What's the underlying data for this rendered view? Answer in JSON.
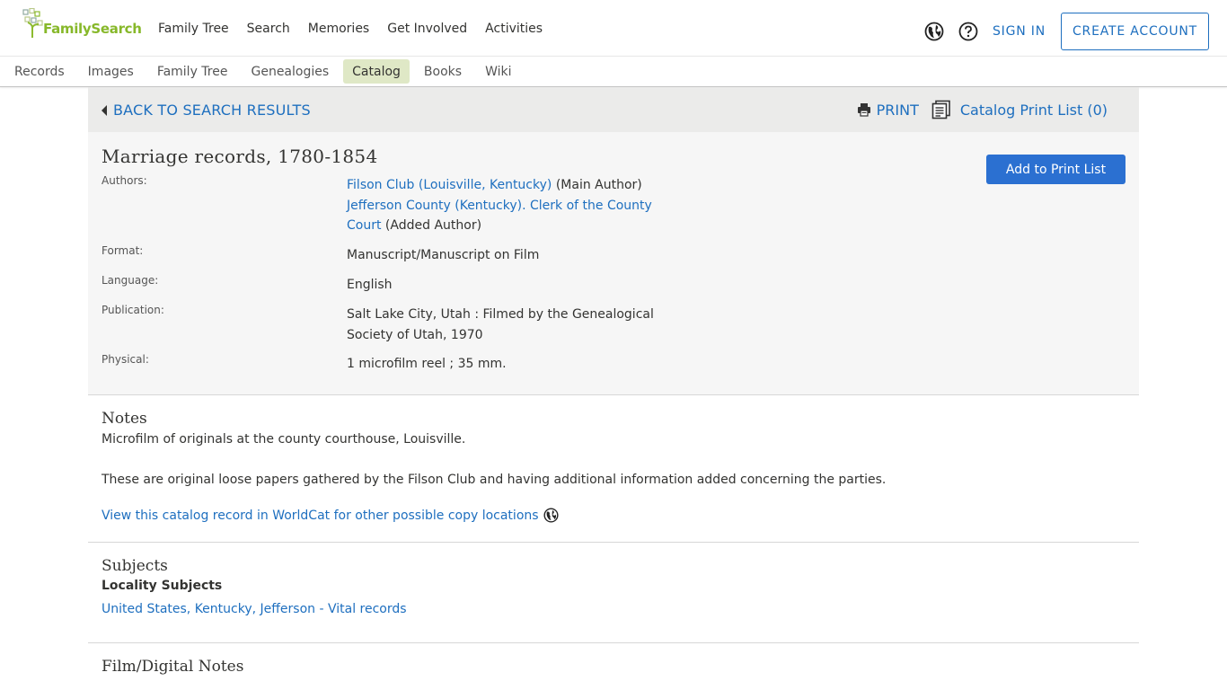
{
  "header": {
    "logo_text": "FamilySearch",
    "nav": [
      "Family Tree",
      "Search",
      "Memories",
      "Get Involved",
      "Activities"
    ],
    "sign_in": "SIGN IN",
    "create_account": "CREATE ACCOUNT"
  },
  "subnav": {
    "items": [
      "Records",
      "Images",
      "Family Tree",
      "Genealogies",
      "Catalog",
      "Books",
      "Wiki"
    ],
    "active": "Catalog"
  },
  "backbar": {
    "back_label": "BACK TO SEARCH RESULTS",
    "print_label": "PRINT",
    "print_list_label": "Catalog Print List (0)"
  },
  "record": {
    "title": "Marriage records, 1780-1854",
    "add_button": "Add to Print List",
    "authors_label": "Authors:",
    "author1_link": "Filson Club (Louisville, Kentucky)",
    "author1_role": "(Main Author)",
    "author2_link_line1": "Jefferson County (Kentucky). Clerk of the County",
    "author2_link_line2": "Court",
    "author2_role": "(Added Author)",
    "format_label": "Format:",
    "format_value": "Manuscript/Manuscript on Film",
    "language_label": "Language:",
    "language_value": "English",
    "publication_label": "Publication:",
    "publication_line1": "Salt Lake City, Utah : Filmed by the Genealogical",
    "publication_line2": "Society of Utah, 1970",
    "physical_label": "Physical:",
    "physical_value": "1 microfilm reel ; 35 mm."
  },
  "notes": {
    "heading": "Notes",
    "line1": "Microfilm of originals at the county courthouse, Louisville.",
    "line2": "These are original loose papers gathered by the Filson Club and having additional information added concerning the parties.",
    "worldcat_link": "View this catalog record in WorldCat for other possible copy locations"
  },
  "subjects": {
    "heading": "Subjects",
    "subheading": "Locality Subjects",
    "link": "United States, Kentucky, Jefferson - Vital records"
  },
  "film_notes": {
    "heading": "Film/Digital Notes"
  },
  "colors": {
    "link": "#1e6fbf",
    "brand_green": "#87b82a",
    "active_tab": "#dfe8c6",
    "primary_button": "#2b70d1"
  }
}
